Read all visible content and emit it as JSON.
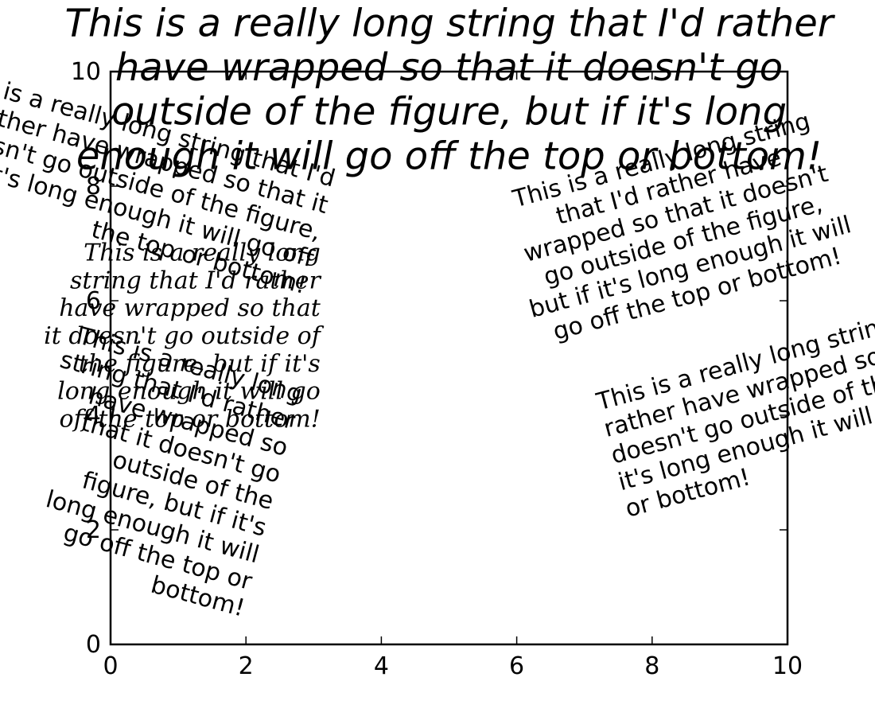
{
  "chart_data": {
    "type": "scatter",
    "title": "",
    "xlabel": "",
    "ylabel": "",
    "xlim": [
      0,
      10
    ],
    "ylim": [
      0,
      10
    ],
    "xticks": [
      0,
      2,
      4,
      6,
      8,
      10
    ],
    "yticks": [
      0,
      2,
      4,
      6,
      8,
      10
    ],
    "xtick_labels": [
      "0",
      "2",
      "4",
      "6",
      "8",
      "10"
    ],
    "ytick_labels": [
      "0",
      "2",
      "4",
      "6",
      "8",
      "10"
    ],
    "grid": false,
    "series": [],
    "annotations": [
      {
        "name": "annotation-center-top",
        "x": 5,
        "y": 9.7,
        "lines": [
          "This is a really long string that I'd rather",
          "have wrapped so that it doesn't go",
          "outside of the figure, but if it's long",
          "enough it will go off the top or bottom!"
        ],
        "rotation": 0,
        "style": "italic",
        "family": "sans",
        "weight": "normal",
        "size": 48,
        "align": "center"
      },
      {
        "name": "annotation-upper-right",
        "x": 8.4,
        "y": 7.3,
        "lines": [
          "This is a really long string",
          "that I'd rather have",
          "wrapped so that it doesn't",
          "go outside of the figure,",
          "but if it's long enough it will",
          "go off the top or bottom!"
        ],
        "rotation": 15,
        "style": "normal",
        "family": "sans",
        "weight": "normal",
        "size": 30,
        "align": "center"
      },
      {
        "name": "annotation-upper-left",
        "x": 3.1,
        "y": 7.2,
        "lines": [
          "This is a really long string that I'd",
          "rather have wrapped so that it",
          "doesn't go outside of the figure,",
          "but if it's long enough it will go off",
          "the top or bottom!"
        ],
        "rotation": -15,
        "style": "normal",
        "family": "sans",
        "weight": "normal",
        "size": 30,
        "align": "right"
      },
      {
        "name": "annotation-left-serif",
        "x": 3.1,
        "y": 5.4,
        "lines": [
          "This is a really long",
          "string that I'd rather",
          "have wrapped so that",
          "it doesn't go outside of",
          "the figure, but if it's",
          "long enough it will go",
          "off the top or bottom!"
        ],
        "rotation": 0,
        "style": "italic",
        "family": "serif",
        "weight": "normal",
        "size": 30,
        "align": "right"
      },
      {
        "name": "annotation-bottom-left",
        "x": 2.4,
        "y": 2.5,
        "lines": [
          "This is a really long",
          "string that I'd rather",
          "have wrapped so",
          "that it doesn't go",
          "outside of the",
          "figure, but if it's",
          "long enough it will",
          "go off the top or",
          "bottom!"
        ],
        "rotation": -15,
        "style": "normal",
        "family": "sans",
        "weight": "normal",
        "size": 30,
        "align": "right"
      },
      {
        "name": "annotation-lower-center",
        "x": 7.4,
        "y": 3.3,
        "lines": [
          "This is a really long string that I'd",
          "rather have wrapped so that it",
          "doesn't go outside of the figure, but if",
          "it's long enough it will go off the top",
          "or bottom!"
        ],
        "rotation": 15,
        "style": "normal",
        "family": "sans",
        "weight": "normal",
        "size": 30,
        "align": "left"
      }
    ]
  }
}
